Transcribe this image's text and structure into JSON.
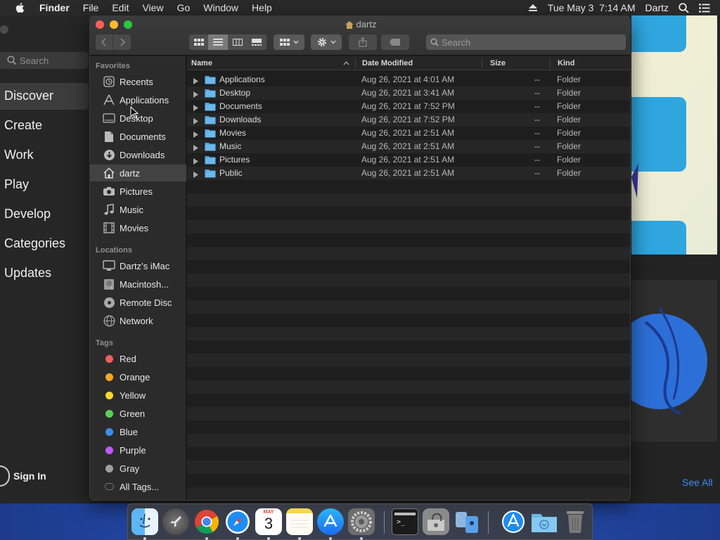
{
  "menubar": {
    "app_name": "Finder",
    "menus": [
      "File",
      "Edit",
      "View",
      "Go",
      "Window",
      "Help"
    ],
    "datetime": "Tue May 3  7:14 AM",
    "user": "Dartz"
  },
  "appstore": {
    "search_placeholder": "Search",
    "nav": [
      "Discover",
      "Create",
      "Work",
      "Play",
      "Develop",
      "Categories",
      "Updates"
    ],
    "active_nav": "Discover",
    "sign_in": "Sign In",
    "see_all": "See All"
  },
  "finder": {
    "title": "dartz",
    "search_placeholder": "Search",
    "sidebar": {
      "favorites_header": "Favorites",
      "favorites": [
        {
          "label": "Recents",
          "icon": "clock-icon"
        },
        {
          "label": "Applications",
          "icon": "applications-icon"
        },
        {
          "label": "Desktop",
          "icon": "desktop-icon"
        },
        {
          "label": "Documents",
          "icon": "document-icon"
        },
        {
          "label": "Downloads",
          "icon": "download-icon"
        },
        {
          "label": "dartz",
          "icon": "home-icon",
          "selected": true
        },
        {
          "label": "Pictures",
          "icon": "camera-icon"
        },
        {
          "label": "Music",
          "icon": "music-note-icon"
        },
        {
          "label": "Movies",
          "icon": "film-icon"
        }
      ],
      "locations_header": "Locations",
      "locations": [
        {
          "label": "Dartz’s iMac",
          "icon": "computer-icon"
        },
        {
          "label": "Macintosh...",
          "icon": "hard-drive-icon"
        },
        {
          "label": "Remote Disc",
          "icon": "disc-icon"
        },
        {
          "label": "Network",
          "icon": "globe-icon"
        }
      ],
      "tags_header": "Tags",
      "tags": [
        {
          "label": "Red",
          "color": "#ec5f5d"
        },
        {
          "label": "Orange",
          "color": "#f5a623"
        },
        {
          "label": "Yellow",
          "color": "#f8d930"
        },
        {
          "label": "Green",
          "color": "#59d158"
        },
        {
          "label": "Blue",
          "color": "#3d8ef0"
        },
        {
          "label": "Purple",
          "color": "#bf5af2"
        },
        {
          "label": "Gray",
          "color": "#a0a0a0"
        },
        {
          "label": "All Tags...",
          "color": "#555555"
        }
      ]
    },
    "columns": {
      "name": "Name",
      "date": "Date Modified",
      "size": "Size",
      "kind": "Kind"
    },
    "files": [
      {
        "name": "Applications",
        "date": "Aug 26, 2021 at 4:01 AM",
        "size": "--",
        "kind": "Folder"
      },
      {
        "name": "Desktop",
        "date": "Aug 26, 2021 at 3:41 AM",
        "size": "--",
        "kind": "Folder"
      },
      {
        "name": "Documents",
        "date": "Aug 26, 2021 at 7:52 PM",
        "size": "--",
        "kind": "Folder"
      },
      {
        "name": "Downloads",
        "date": "Aug 26, 2021 at 7:52 PM",
        "size": "--",
        "kind": "Folder"
      },
      {
        "name": "Movies",
        "date": "Aug 26, 2021 at 2:51 AM",
        "size": "--",
        "kind": "Folder"
      },
      {
        "name": "Music",
        "date": "Aug 26, 2021 at 2:51 AM",
        "size": "--",
        "kind": "Folder"
      },
      {
        "name": "Pictures",
        "date": "Aug 26, 2021 at 2:51 AM",
        "size": "--",
        "kind": "Folder"
      },
      {
        "name": "Public",
        "date": "Aug 26, 2021 at 2:51 AM",
        "size": "--",
        "kind": "Folder"
      }
    ]
  },
  "dock": {
    "calendar_month": "MAY",
    "calendar_day": "3",
    "apps": [
      "finder-icon",
      "launchpad-icon",
      "chrome-icon",
      "safari-icon",
      "calendar-icon",
      "notes-icon",
      "app-store-icon",
      "system-preferences-icon",
      "terminal-icon",
      "disk-utility-icon",
      "migration-assistant-icon",
      "app-store-downloads-icon",
      "downloads-folder-icon",
      "trash-icon"
    ]
  }
}
